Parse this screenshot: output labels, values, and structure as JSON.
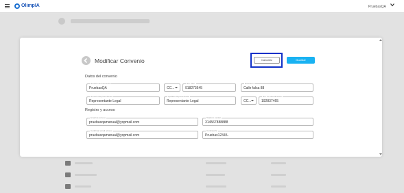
{
  "topbar": {
    "logo_text": "OlimpIA",
    "user_name": "PruebasQA",
    "menu_icon": "hamburger-icon",
    "chevron_icon": "chevron-down-icon"
  },
  "modal": {
    "title": "Modificar Convenio",
    "cancel_label": "Cancelar",
    "save_label": "Guardar",
    "section_convenio": "Datos del convenio",
    "section_registro": "Registro y acceso",
    "colors": {
      "save": "#19b2f2",
      "highlight": "#1030c8"
    }
  },
  "convenio": {
    "nombre": {
      "label": "Nombre del convenio",
      "value": "PruebasQA"
    },
    "tipo_doc": {
      "value": "CC..."
    },
    "num_doc": {
      "label": "Nro. Doc.",
      "value": "918273645"
    },
    "direccion": {
      "label": "Dirección",
      "value": "Calle falsa 88"
    },
    "rep_nombre": {
      "label": "Nombre Representante",
      "value": "Representante Legal"
    },
    "rep_apellido": {
      "label": "Apellido Representante",
      "value": "Representante Legal"
    },
    "rep_tipo_doc": {
      "value": "CC..."
    },
    "rep_num_doc": {
      "label": "Nro. de identificación",
      "value": "192837465"
    }
  },
  "registro": {
    "email": {
      "label": "Email de acceso",
      "value": "pruebasqamanual@yopmail.com"
    },
    "telefono": {
      "label": "Teléfono celular",
      "value": "314567888888"
    },
    "email_confirm": {
      "label": "Confirmar email acceso",
      "value": "pruebasqamanual@yopmail.com"
    },
    "password": {
      "label": "Contraseña",
      "value": "Pruebas12345-"
    }
  }
}
